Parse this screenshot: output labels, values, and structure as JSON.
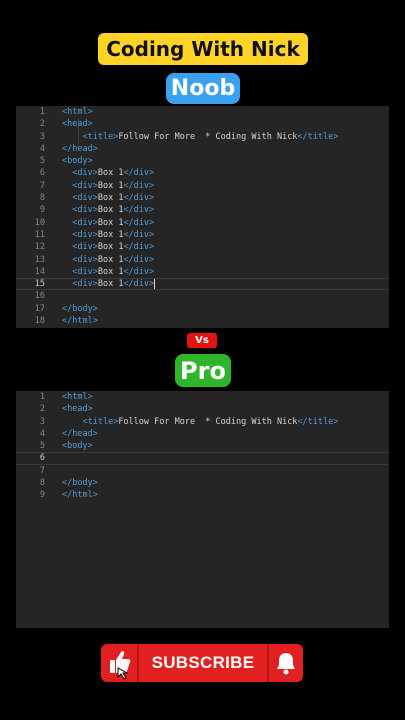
{
  "header": {
    "banner": "Coding With Nick"
  },
  "labels": {
    "noob": "Noob",
    "vs": "Vs",
    "pro": "Pro"
  },
  "noob_editor": {
    "lines": [
      {
        "n": "1",
        "parts": [
          [
            "tag",
            "<html>"
          ]
        ]
      },
      {
        "n": "2",
        "parts": [
          [
            "tag",
            "<head>"
          ]
        ]
      },
      {
        "n": "3",
        "parts": [
          [
            "sp",
            "    "
          ],
          [
            "tag",
            "<title>"
          ],
          [
            "txt",
            "Follow For More  * Coding With Nick"
          ],
          [
            "tag",
            "</title>"
          ]
        ]
      },
      {
        "n": "4",
        "parts": [
          [
            "tag",
            "</head>"
          ]
        ]
      },
      {
        "n": "5",
        "parts": [
          [
            "tag",
            "<body>"
          ]
        ]
      },
      {
        "n": "6",
        "parts": [
          [
            "sp",
            "  "
          ],
          [
            "tag",
            "<div>"
          ],
          [
            "txt",
            "Box 1"
          ],
          [
            "tag",
            "</div>"
          ]
        ]
      },
      {
        "n": "7",
        "parts": [
          [
            "sp",
            "  "
          ],
          [
            "tag",
            "<div>"
          ],
          [
            "txt",
            "Box 1"
          ],
          [
            "tag",
            "</div>"
          ]
        ]
      },
      {
        "n": "8",
        "parts": [
          [
            "sp",
            "  "
          ],
          [
            "tag",
            "<div>"
          ],
          [
            "txt",
            "Box 1"
          ],
          [
            "tag",
            "</div>"
          ]
        ]
      },
      {
        "n": "9",
        "parts": [
          [
            "sp",
            "  "
          ],
          [
            "tag",
            "<div>"
          ],
          [
            "txt",
            "Box 1"
          ],
          [
            "tag",
            "</div>"
          ]
        ]
      },
      {
        "n": "10",
        "parts": [
          [
            "sp",
            "  "
          ],
          [
            "tag",
            "<div>"
          ],
          [
            "txt",
            "Box 1"
          ],
          [
            "tag",
            "</div>"
          ]
        ]
      },
      {
        "n": "11",
        "parts": [
          [
            "sp",
            "  "
          ],
          [
            "tag",
            "<div>"
          ],
          [
            "txt",
            "Box 1"
          ],
          [
            "tag",
            "</div>"
          ]
        ]
      },
      {
        "n": "12",
        "parts": [
          [
            "sp",
            "  "
          ],
          [
            "tag",
            "<div>"
          ],
          [
            "txt",
            "Box 1"
          ],
          [
            "tag",
            "</div>"
          ]
        ]
      },
      {
        "n": "13",
        "parts": [
          [
            "sp",
            "  "
          ],
          [
            "tag",
            "<div>"
          ],
          [
            "txt",
            "Box 1"
          ],
          [
            "tag",
            "</div>"
          ]
        ]
      },
      {
        "n": "14",
        "parts": [
          [
            "sp",
            "  "
          ],
          [
            "tag",
            "<div>"
          ],
          [
            "txt",
            "Box 1"
          ],
          [
            "tag",
            "</div>"
          ]
        ]
      },
      {
        "n": "15",
        "active": true,
        "caret": true,
        "parts": [
          [
            "sp",
            "  "
          ],
          [
            "tag",
            "<div>"
          ],
          [
            "txt",
            "Box 1"
          ],
          [
            "tag",
            "</div>"
          ]
        ]
      },
      {
        "n": "16",
        "parts": []
      },
      {
        "n": "17",
        "parts": [
          [
            "tag",
            "</body>"
          ]
        ]
      },
      {
        "n": "18",
        "parts": [
          [
            "tag",
            "</html>"
          ]
        ]
      }
    ]
  },
  "pro_editor": {
    "lines": [
      {
        "n": "1",
        "parts": [
          [
            "tag",
            "<html>"
          ]
        ]
      },
      {
        "n": "2",
        "parts": [
          [
            "tag",
            "<head>"
          ]
        ]
      },
      {
        "n": "3",
        "parts": [
          [
            "sp",
            "    "
          ],
          [
            "tag",
            "<title>"
          ],
          [
            "txt",
            "Follow For More  * Coding With Nick"
          ],
          [
            "tag",
            "</title>"
          ]
        ]
      },
      {
        "n": "4",
        "parts": [
          [
            "tag",
            "</head>"
          ]
        ]
      },
      {
        "n": "5",
        "parts": [
          [
            "tag",
            "<body>"
          ]
        ]
      },
      {
        "n": "6",
        "active": true,
        "parts": []
      },
      {
        "n": "7",
        "parts": []
      },
      {
        "n": "8",
        "parts": [
          [
            "tag",
            "</body>"
          ]
        ]
      },
      {
        "n": "9",
        "parts": [
          [
            "tag",
            "</html>"
          ]
        ]
      }
    ]
  },
  "subscribe": {
    "label": "SUBSCRIBE",
    "like_icon": "thumbs-up-icon",
    "bell_icon": "bell-icon"
  },
  "colors": {
    "banner": "#ffd426",
    "noob": "#3aa0f0",
    "pro": "#2fb52c",
    "vs": "#e41313",
    "subscribe": "#e32020",
    "tag": "#569cd6",
    "editor_bg": "#252526"
  }
}
